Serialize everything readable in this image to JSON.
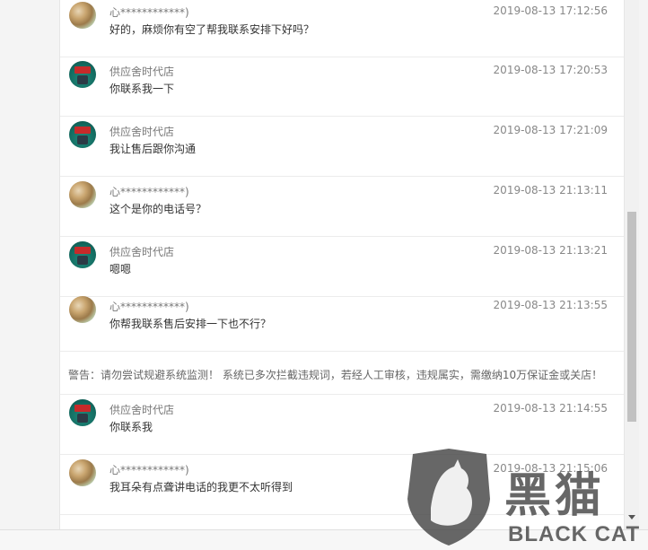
{
  "messages": [
    {
      "sender": "心************)",
      "time": "2019-08-13 17:12:56",
      "text": "好的，麻烦你有空了帮我联系安排下好吗？",
      "avatar": "user-avatar-icon"
    },
    {
      "sender": "供应舍时代店",
      "time": "2019-08-13 17:20:53",
      "text": "你联系我一下",
      "avatar": "shop-avatar-icon"
    },
    {
      "sender": "供应舍时代店",
      "time": "2019-08-13 17:21:09",
      "text": "我让售后跟你沟通",
      "avatar": "shop-avatar-icon"
    },
    {
      "sender": "心************)",
      "time": "2019-08-13 21:13:11",
      "text": "这个是你的电话号？",
      "avatar": "user-avatar-icon"
    },
    {
      "sender": "供应舍时代店",
      "time": "2019-08-13 21:13:21",
      "text": "嗯嗯",
      "avatar": "shop-avatar-icon"
    },
    {
      "sender": "心************)",
      "time": "2019-08-13 21:13:55",
      "text": "你帮我联系售后安排一下也不行？",
      "avatar": "user-avatar-icon"
    },
    {
      "sender": "供应舍时代店",
      "time": "2019-08-13 21:14:55",
      "text": "你联系我",
      "avatar": "shop-avatar-icon"
    },
    {
      "sender": "心************)",
      "time": "2019-08-13 21:15:06",
      "text": "我耳朵有点聋讲电话的我更不太听得到",
      "avatar": "user-avatar-icon"
    }
  ],
  "warning": "警告：请勿尝试规避系统监测！ 系统已多次拦截违规词，若经人工审核，违规属实，需缴纳10万保证金或关店！",
  "watermark": {
    "cn": "黑猫",
    "en": "BLACK CAT"
  },
  "colors": {
    "panel": "#ffffff",
    "background": "#f4f4f4",
    "divider": "#ececec",
    "shop_avatar": "#146e63",
    "shop_sign": "#c72a2a"
  }
}
